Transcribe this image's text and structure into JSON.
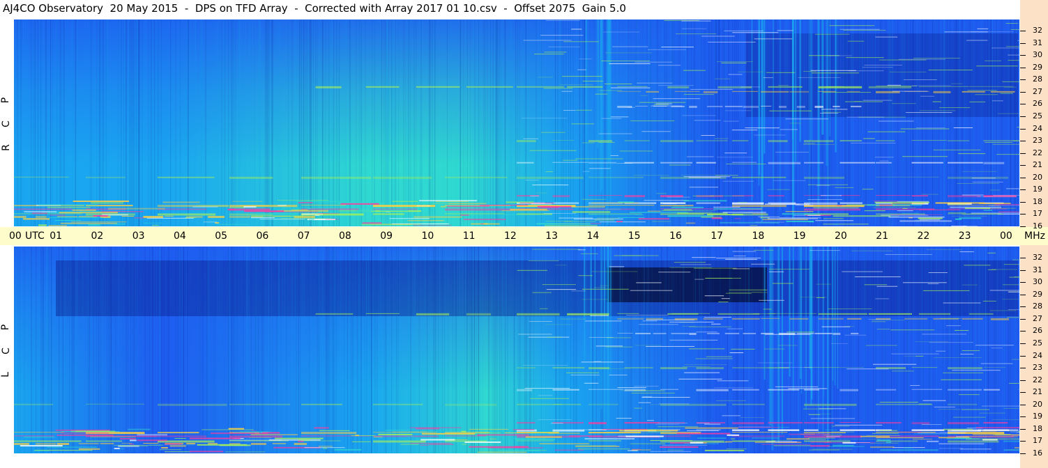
{
  "title": "AJ4CO Observatory  20 May 2015  -  DPS on TFD Array  -  Corrected with Array 2017 01 10.csv  -  Offset 2075  Gain 5.0",
  "time_axis": {
    "labels": [
      "00",
      "01",
      "02",
      "03",
      "04",
      "05",
      "06",
      "07",
      "08",
      "09",
      "10",
      "11",
      "12",
      "13",
      "14",
      "15",
      "16",
      "17",
      "18",
      "19",
      "20",
      "21",
      "22",
      "23",
      "00"
    ],
    "unit_label": "UTC",
    "freq_unit_label": "MHz"
  },
  "panels": [
    {
      "id": "rcp",
      "pol_letters": [
        "R",
        "C",
        "P"
      ],
      "freq_ticks": [
        "32",
        "31",
        "30",
        "29",
        "28",
        "27",
        "26",
        "25",
        "24",
        "23",
        "22",
        "21",
        "20",
        "19",
        "18",
        "17",
        "16"
      ]
    },
    {
      "id": "lcp",
      "pol_letters": [
        "L",
        "C",
        "P"
      ],
      "freq_ticks": [
        "32",
        "31",
        "30",
        "29",
        "28",
        "27",
        "26",
        "25",
        "24",
        "23",
        "22",
        "21",
        "20",
        "19",
        "18",
        "17",
        "16"
      ]
    }
  ],
  "colors": {
    "low": "#0a1e8c",
    "mid_low": "#1e5cf0",
    "mid": "#1aa6f0",
    "mid_high": "#2fd8d0",
    "high": "#a6f05a",
    "peak": "#ffd040",
    "extreme": "#ff3ca0",
    "timebar_bg": "#fffccb",
    "axis_bg": "#fde1c6"
  },
  "chart_data": {
    "type": "heatmap",
    "title": "AJ4CO Observatory  20 May 2015  -  DPS on TFD Array  -  Corrected with Array 2017 01 10.csv  -  Offset 2075  Gain 5.0",
    "x_axis": {
      "label": "UTC",
      "range_hours": [
        0,
        24
      ]
    },
    "y_axis": {
      "label": "MHz",
      "range": [
        16,
        32
      ]
    },
    "panels": [
      "RCP",
      "LCP"
    ],
    "features": [
      {
        "type": "rfi_band_mhz",
        "value": 17.5
      },
      {
        "type": "rfi_band_mhz",
        "value": 27
      },
      {
        "type": "interference_utc_hours",
        "start": 13.6,
        "end": 14.4
      },
      {
        "type": "interference_utc_hours",
        "start": 17.6,
        "end": 19.7
      }
    ]
  }
}
